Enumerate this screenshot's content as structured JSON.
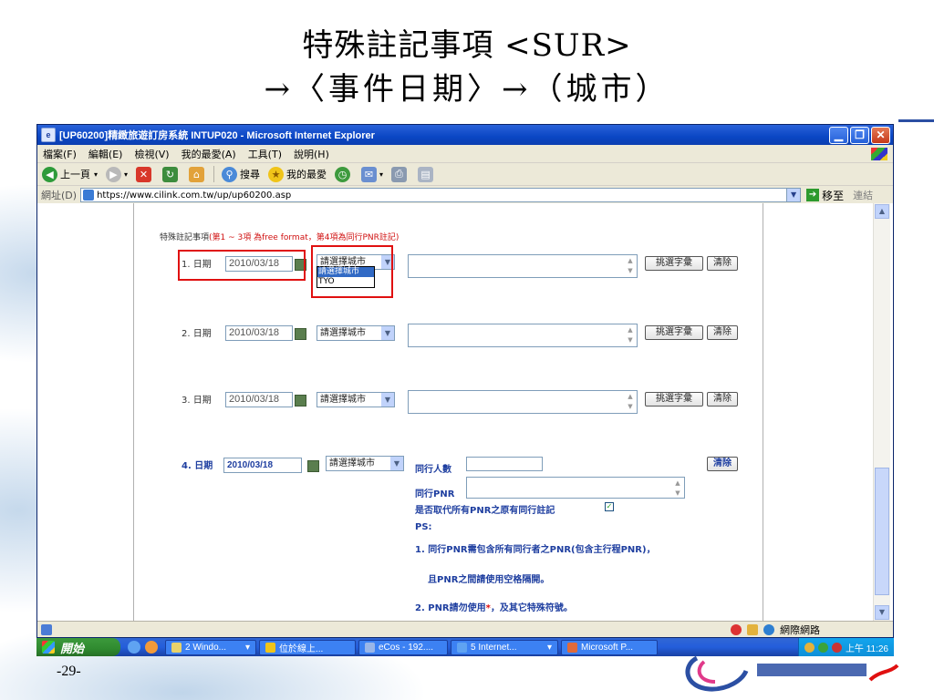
{
  "slide": {
    "title_line1": "特殊註記事項 <SUR>",
    "title_line2": "→〈事件日期〉→（城市）",
    "page_number": "-29-"
  },
  "window": {
    "title": "[UP60200]精緻旅遊訂房系統 INTUP020 - Microsoft Internet Explorer",
    "menu": [
      "檔案(F)",
      "編輯(E)",
      "檢視(V)",
      "我的最愛(A)",
      "工具(T)",
      "說明(H)"
    ],
    "toolbar": {
      "back": "上一頁",
      "search": "搜尋",
      "favorites": "我的最愛"
    },
    "address": {
      "label": "網址(D)",
      "url": "https://www.cilink.com.tw/up/up60200.asp",
      "go": "移至",
      "links": "連結"
    },
    "status": {
      "zone": "網際網路"
    }
  },
  "form": {
    "heading": "特殊註記事項",
    "heading_note": "(第1 ~ 3項 為free format，第4項為同行PNR註記)",
    "rows": [
      {
        "label": "1. 日期",
        "date": "2010/03/18",
        "city": "請選擇城市"
      },
      {
        "label": "2. 日期",
        "date": "2010/03/18",
        "city": "請選擇城市"
      },
      {
        "label": "3. 日期",
        "date": "2010/03/18",
        "city": "請選擇城市"
      }
    ],
    "dropdown_options": [
      "請選擇城市",
      "TYO"
    ],
    "pick_button": "挑選字彙",
    "clear_button": "清除",
    "row4": {
      "label": "4. 日期",
      "date": "2010/03/18",
      "city": "請選擇城市",
      "companions_label": "同行人數",
      "pnr_label": "同行PNR",
      "replace_label": "是否取代所有PNR之原有同行註記",
      "ps": "PS:",
      "note1": "1. 同行PNR需包含所有同行者之PNR(包含主行程PNR)，",
      "note1b": "且PNR之間請使用空格隔開。",
      "note2a": "2. PNR請勿使用",
      "note2b": "，及其它特殊符號。",
      "clear": "清除"
    }
  },
  "taskbar": {
    "start": "開始",
    "tasks": [
      "2 Windo...",
      "位於線上...",
      "eCos - 192....",
      "5 Internet...",
      "Microsoft P..."
    ],
    "clock": "上午 11:26"
  },
  "colors": {
    "titlebar": "#0a46c4",
    "highlight_box": "#e01010",
    "taskbar": "#245edb"
  }
}
